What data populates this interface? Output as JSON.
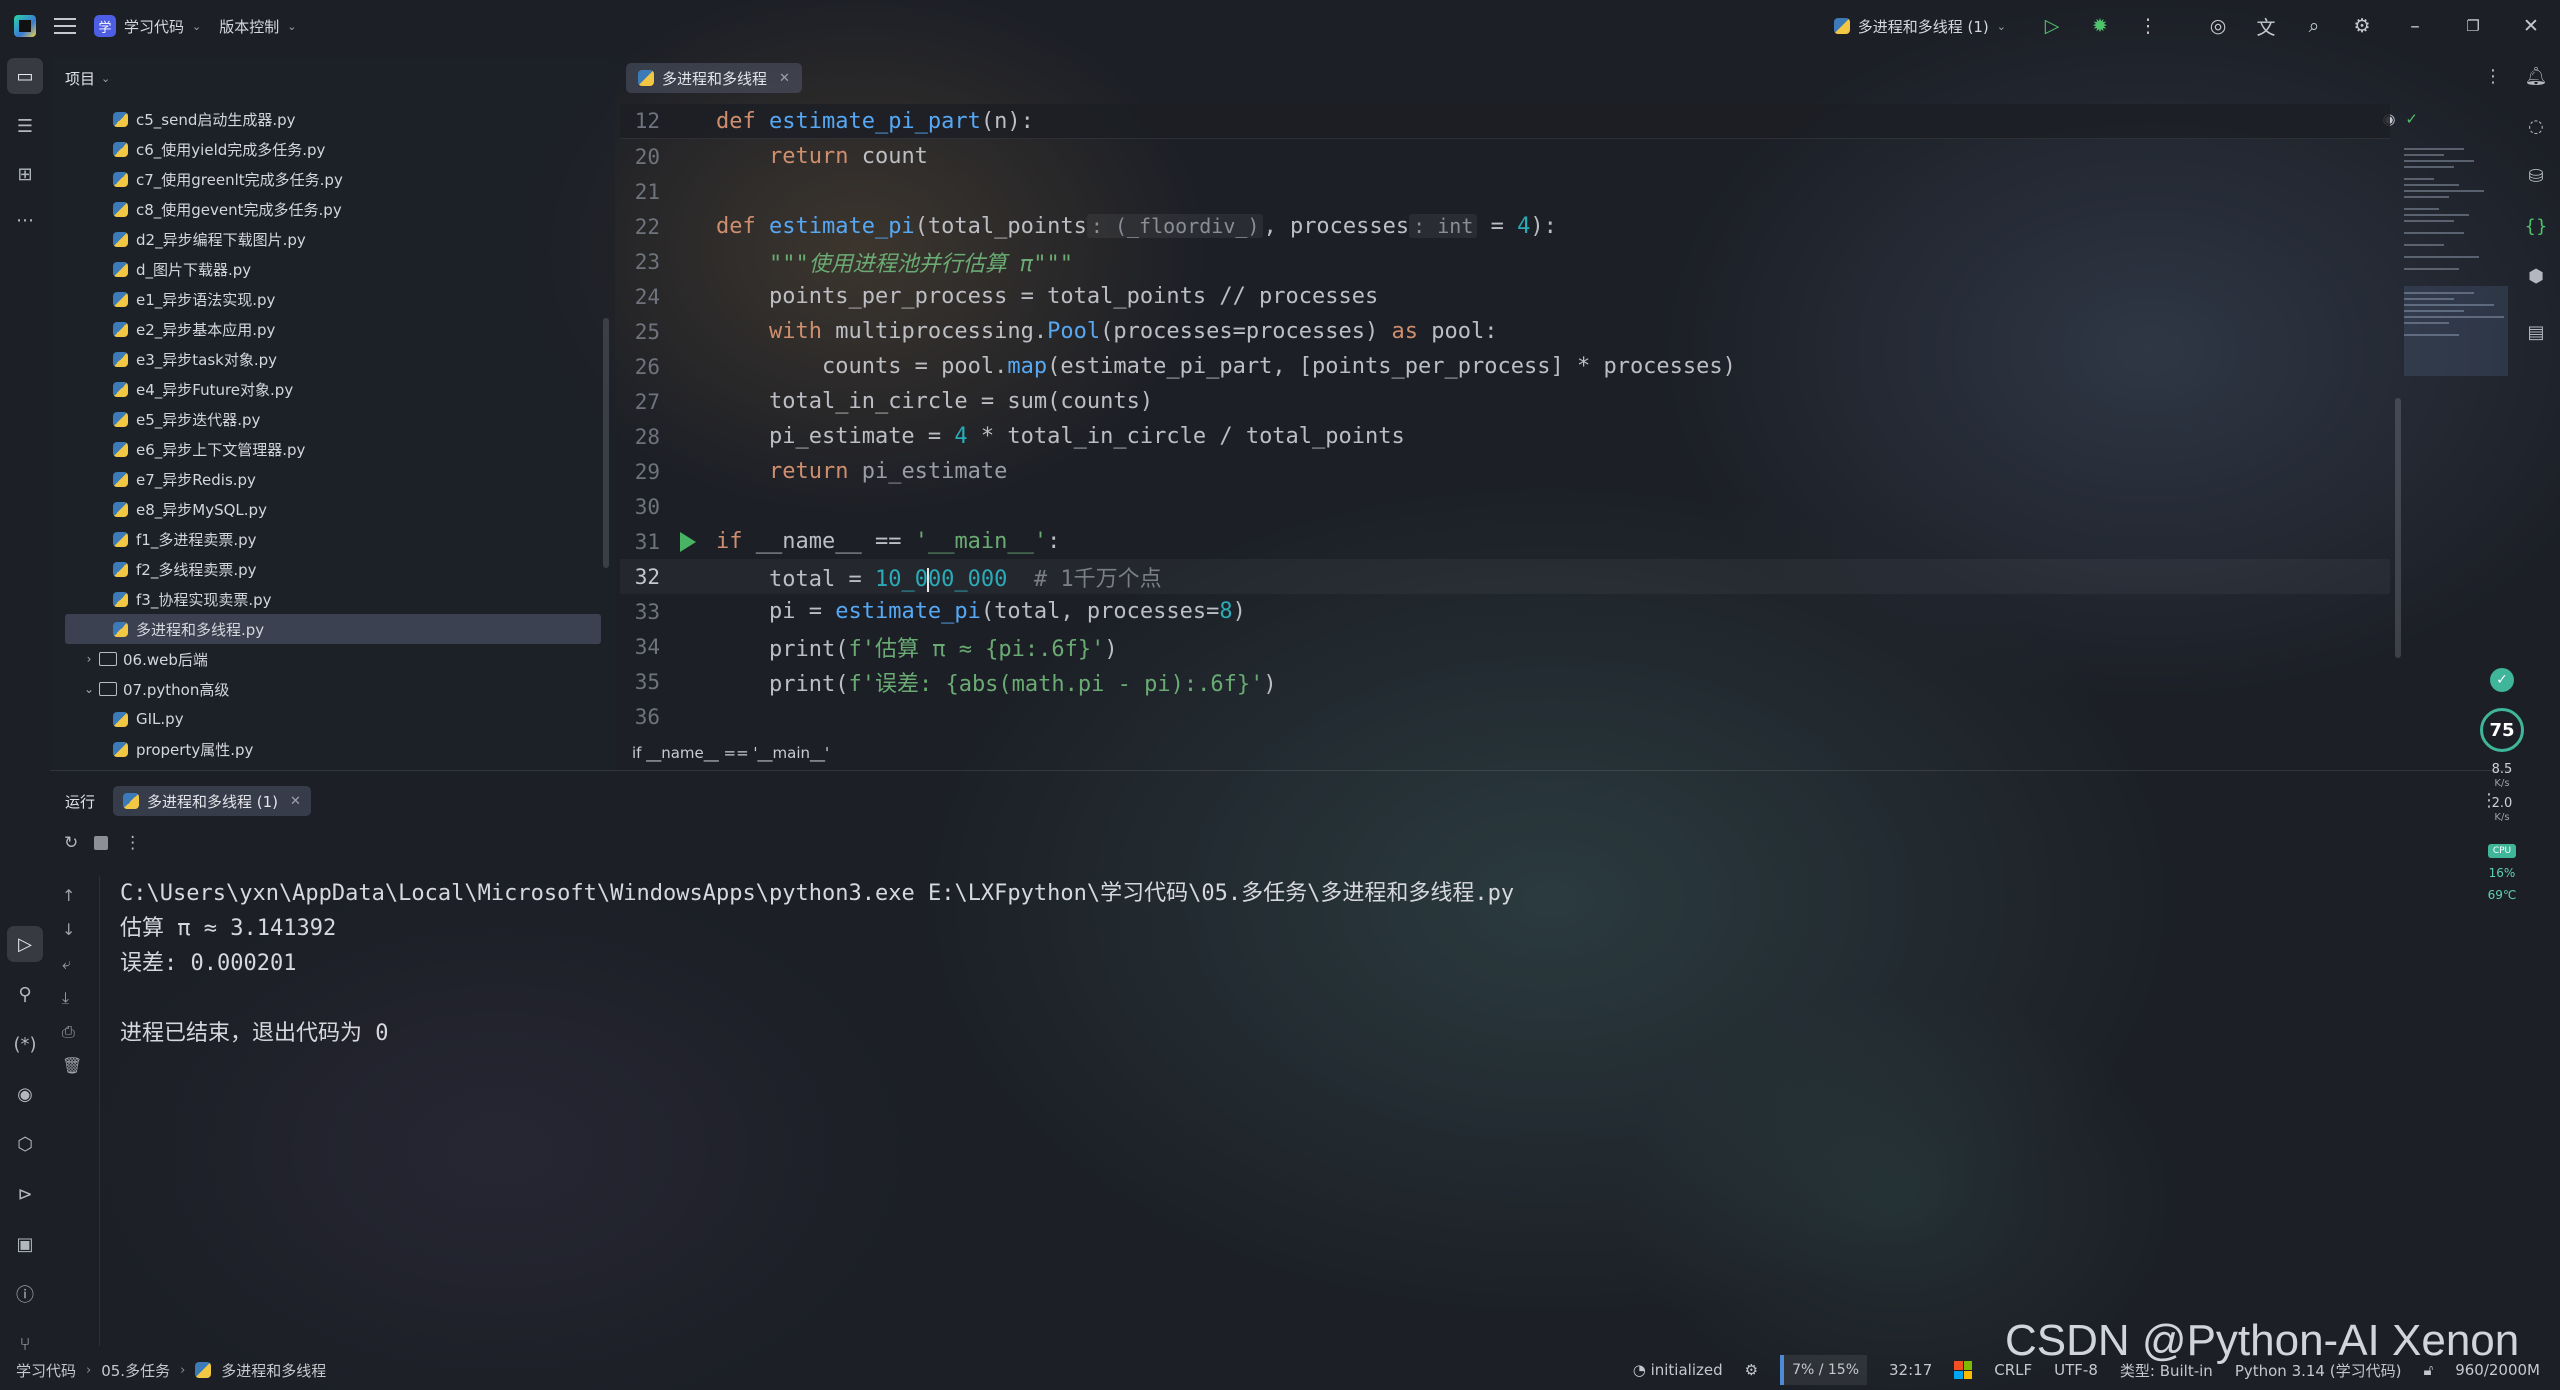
{
  "titlebar": {
    "project": "学习代码",
    "project_initial": "学",
    "vcs": "版本控制",
    "run_config": "多进程和多线程 (1)"
  },
  "project_panel": {
    "title": "项目",
    "files": [
      "c5_send启动生成器.py",
      "c6_使用yield完成多任务.py",
      "c7_使用greenlt完成多任务.py",
      "c8_使用gevent完成多任务.py",
      "d2_异步编程下载图片.py",
      "d_图片下载器.py",
      "e1_异步语法实现.py",
      "e2_异步基本应用.py",
      "e3_异步task对象.py",
      "e4_异步Future对象.py",
      "e5_异步迭代器.py",
      "e6_异步上下文管理器.py",
      "e7_异步Redis.py",
      "e8_异步MySQL.py",
      "f1_多进程卖票.py",
      "f2_多线程卖票.py",
      "f3_协程实现卖票.py",
      "多进程和多线程.py"
    ],
    "folder1": "06.web后端",
    "folder2": "07.python高级",
    "files2": [
      "GIL.py",
      "property属性.py"
    ]
  },
  "editor": {
    "tab": "多进程和多线程",
    "breadcrumb": "if __name__ == '__main__'",
    "line_numbers": [
      "12",
      "20",
      "21",
      "22",
      "23",
      "24",
      "25",
      "26",
      "27",
      "28",
      "29",
      "30",
      "31",
      "32",
      "33",
      "34",
      "35",
      "36"
    ],
    "code": {
      "l12_def": "def ",
      "l12_fn": "estimate_pi_part",
      "l12_rest": "(n):",
      "l20_ret": "return ",
      "l20_val": "count",
      "l22_def": "def ",
      "l22_fn": "estimate_pi",
      "l22_p1": "(total_points",
      "l22_h1": ": (_floordiv_)",
      "l22_p2": ", processes",
      "l22_h2": ": int",
      "l22_p3": " = ",
      "l22_n": "4",
      "l22_p4": "):",
      "l23_doc": "\"\"\"使用进程池并行估算 π\"\"\"",
      "l24": "points_per_process = total_points // processes",
      "l25_with": "with ",
      "l25_a": "multiprocessing.",
      "l25_pool": "Pool",
      "l25_b": "(processes=processes) ",
      "l25_as": "as ",
      "l25_c": "pool:",
      "l26_a": "counts = pool.",
      "l26_map": "map",
      "l26_b": "(estimate_pi_part, [points_per_process] * processes)",
      "l27": "total_in_circle = sum(counts)",
      "l28_a": "pi_estimate = ",
      "l28_n": "4",
      "l28_b": " * total_in_circle / total_points",
      "l29_ret": "return ",
      "l29_val": "pi_estimate",
      "l31_if": "if ",
      "l31_a": "__name__ == ",
      "l31_s": "'__main__'",
      "l31_b": ":",
      "l32_a": "total = ",
      "l32_n1": "10_0",
      "l32_n2": "00_000",
      "l32_c": "  # 1千万个点",
      "l33_a": "pi = ",
      "l33_fn": "estimate_pi",
      "l33_b": "(total, processes=",
      "l33_n": "8",
      "l33_c": ")",
      "l34_a": "print(",
      "l34_s": "f'估算 π ≈ {pi:.6f}'",
      "l34_b": ")",
      "l35_a": "print(",
      "l35_s": "f'误差: {abs(math.pi - pi):.6f}'",
      "l35_b": ")"
    }
  },
  "run_panel": {
    "title": "运行",
    "tab": "多进程和多线程 (1)",
    "output": [
      "C:\\Users\\yxn\\AppData\\Local\\Microsoft\\WindowsApps\\python3.exe E:\\LXFpython\\学习代码\\05.多任务\\多进程和多线程.py",
      "估算 π ≈ 3.141392",
      "误差: 0.000201",
      "",
      "进程已结束，退出代码为 0"
    ]
  },
  "widget": {
    "score": "75",
    "up": "8.5",
    "up_unit": "K/s",
    "down": "2.0",
    "down_unit": "K/s",
    "cpu_label": "CPU",
    "cpu": "16%",
    "temp": "69℃"
  },
  "statusbar": {
    "crumb1": "学习代码",
    "crumb2": "05.多任务",
    "crumb3": "多进程和多线程",
    "initialized": "initialized",
    "mem": "7% / 15%",
    "position": "32:17",
    "line_sep": "CRLF",
    "encoding": "UTF-8",
    "type": "类型: Built-in",
    "interpreter": "Python 3.14 (学习代码)",
    "heap": "960/2000M"
  },
  "watermark": "CSDN @Python-AI Xenon"
}
